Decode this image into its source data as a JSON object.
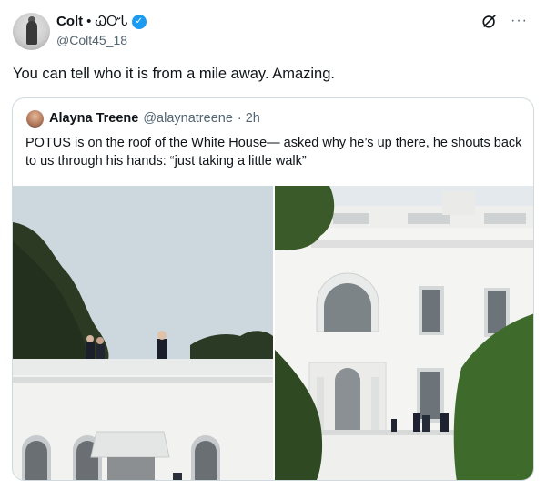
{
  "post": {
    "author_name": "Colt",
    "author_name_suffix": "• ᏇᏅᏓ",
    "author_handle": "@Colt45_18",
    "text": "You can tell who it is from a mile away. Amazing.",
    "verified_badge": "✓",
    "more_glyph": "···"
  },
  "quote": {
    "author_name": "Alayna Treene",
    "author_handle": "@alaynatreene",
    "time": "· 2h",
    "text": "POTUS is on the roof of the White House— asked why he’s up there, he shouts back to us through his hands: “just taking a little walk”"
  },
  "icons": {
    "verified": "verified-badge-icon",
    "grok": "grok-icon",
    "more": "more-options-icon"
  },
  "colors": {
    "verified_blue": "#1d9bf0",
    "text_primary": "#0f1419",
    "text_secondary": "#536471",
    "border": "#cfd9de"
  }
}
